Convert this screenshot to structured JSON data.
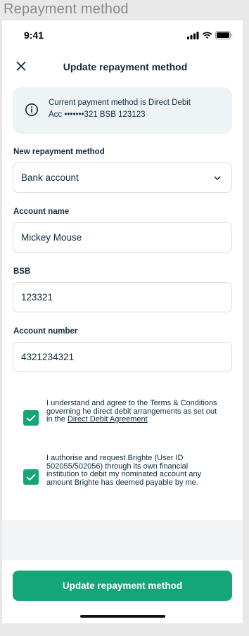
{
  "frame": {
    "title": "Repayment method"
  },
  "status_bar": {
    "time": "9:41"
  },
  "header": {
    "title": "Update repayment method"
  },
  "info": {
    "line1": "Current payment method is Direct Debit",
    "line2": "Acc •••••••321 BSB 123123"
  },
  "form": {
    "method_label": "New repayment method",
    "method_value": "Bank account",
    "account_name_label": "Account name",
    "account_name_value": "Mickey Mouse",
    "bsb_label": "BSB",
    "bsb_value": "123321",
    "account_number_label": "Account number",
    "account_number_value": "4321234321"
  },
  "consents": {
    "terms_text": "I understand and agree to the Terms & Conditions governing he direct debit arrangements as set out in the ",
    "terms_link": "Direct Debit Agreement",
    "terms_checked": true,
    "authorise_text": "I authorise and request Brighte (User ID 502055/502056) through its own financial institution to debit my nominated account any amount Brighte has deemed payable by me.",
    "authorise_checked": true
  },
  "cta": {
    "label": "Update repayment method"
  },
  "colors": {
    "accent": "#14a578",
    "text": "#0f2b3d",
    "info_bg": "#eef3f5"
  }
}
